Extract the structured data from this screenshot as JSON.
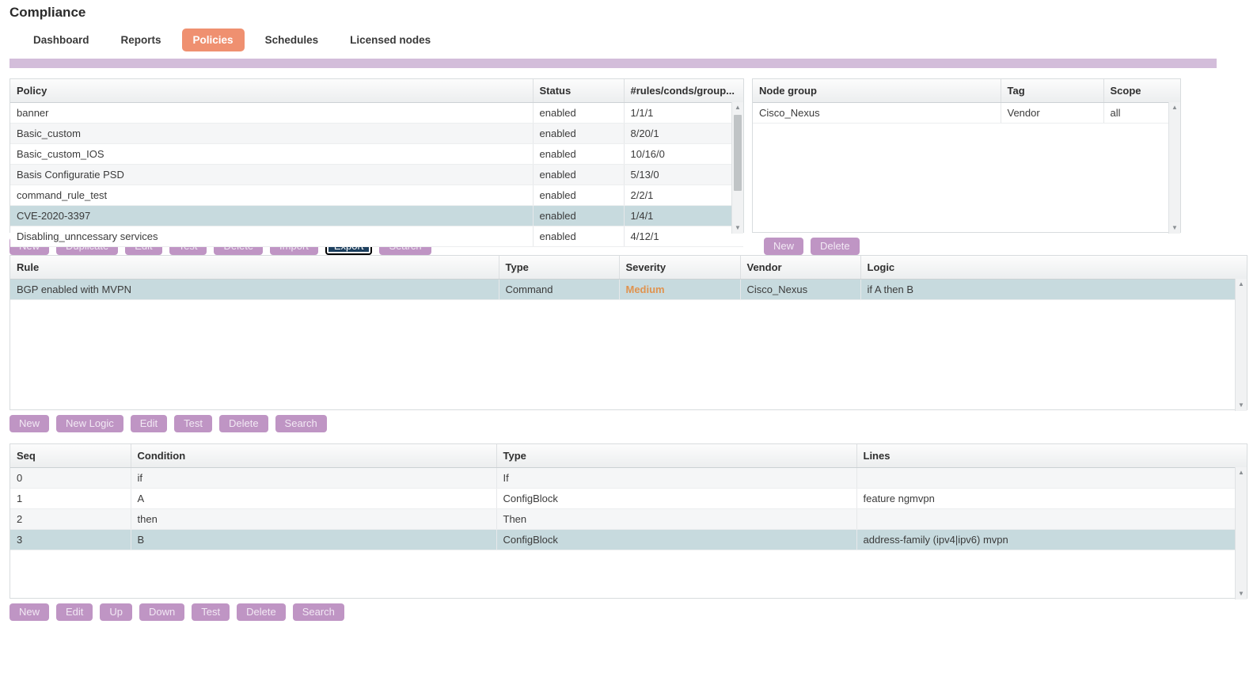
{
  "header": {
    "title": "Compliance",
    "tabs": [
      {
        "label": "Dashboard",
        "active": false
      },
      {
        "label": "Reports",
        "active": false
      },
      {
        "label": "Policies",
        "active": true
      },
      {
        "label": "Schedules",
        "active": false
      },
      {
        "label": "Licensed nodes",
        "active": false
      }
    ],
    "accent_color": "#d3bdda",
    "active_tab_color": "#ef9070"
  },
  "policy_table": {
    "columns": [
      "Policy",
      "Status",
      "#rules/conds/group..."
    ],
    "rows": [
      {
        "policy": "banner",
        "status": "enabled",
        "counts": "1/1/1",
        "selected": false
      },
      {
        "policy": "Basic_custom",
        "status": "enabled",
        "counts": "8/20/1",
        "selected": false
      },
      {
        "policy": "Basic_custom_IOS",
        "status": "enabled",
        "counts": "10/16/0",
        "selected": false
      },
      {
        "policy": "Basis Configuratie PSD",
        "status": "enabled",
        "counts": "5/13/0",
        "selected": false
      },
      {
        "policy": "command_rule_test",
        "status": "enabled",
        "counts": "2/2/1",
        "selected": false
      },
      {
        "policy": "CVE-2020-3397",
        "status": "enabled",
        "counts": "1/4/1",
        "selected": true
      },
      {
        "policy": "Disabling_unncessary services",
        "status": "enabled",
        "counts": "4/12/1",
        "selected": false
      }
    ]
  },
  "policy_buttons": [
    {
      "label": "New",
      "focused": false
    },
    {
      "label": "Duplicate",
      "focused": false
    },
    {
      "label": "Edit",
      "focused": false
    },
    {
      "label": "Test",
      "focused": false
    },
    {
      "label": "Delete",
      "focused": false
    },
    {
      "label": "Import",
      "focused": false
    },
    {
      "label": "Export",
      "focused": true
    },
    {
      "label": "Search",
      "focused": false
    }
  ],
  "nodegroup_table": {
    "columns": [
      "Node group",
      "Tag",
      "Scope"
    ],
    "rows": [
      {
        "node_group": "Cisco_Nexus",
        "tag": "Vendor",
        "scope": "all",
        "selected": false
      }
    ]
  },
  "nodegroup_buttons": [
    {
      "label": "New",
      "focused": false
    },
    {
      "label": "Delete",
      "focused": false
    }
  ],
  "rule_table": {
    "columns": [
      "Rule",
      "Type",
      "Severity",
      "Vendor",
      "Logic"
    ],
    "rows": [
      {
        "rule": "BGP enabled with MVPN",
        "type": "Command",
        "severity": "Medium",
        "severity_color": "#e0934f",
        "vendor": "Cisco_Nexus",
        "logic": "if A then B",
        "selected": true
      }
    ]
  },
  "rule_buttons": [
    {
      "label": "New",
      "focused": false
    },
    {
      "label": "New Logic",
      "focused": false
    },
    {
      "label": "Edit",
      "focused": false
    },
    {
      "label": "Test",
      "focused": false
    },
    {
      "label": "Delete",
      "focused": false
    },
    {
      "label": "Search",
      "focused": false
    }
  ],
  "condition_table": {
    "columns": [
      "Seq",
      "Condition",
      "Type",
      "Lines"
    ],
    "rows": [
      {
        "seq": "0",
        "condition": "if",
        "type": "If",
        "lines": "",
        "selected": false
      },
      {
        "seq": "1",
        "condition": "A",
        "type": "ConfigBlock",
        "lines": "feature ngmvpn",
        "selected": false
      },
      {
        "seq": "2",
        "condition": "then",
        "type": "Then",
        "lines": "",
        "selected": false
      },
      {
        "seq": "3",
        "condition": "B",
        "type": "ConfigBlock",
        "lines": "address-family (ipv4|ipv6) mvpn",
        "selected": true
      }
    ]
  },
  "condition_buttons": [
    {
      "label": "New",
      "focused": false
    },
    {
      "label": "Edit",
      "focused": false
    },
    {
      "label": "Up",
      "focused": false
    },
    {
      "label": "Down",
      "focused": false
    },
    {
      "label": "Test",
      "focused": false
    },
    {
      "label": "Delete",
      "focused": false
    },
    {
      "label": "Search",
      "focused": false
    }
  ]
}
